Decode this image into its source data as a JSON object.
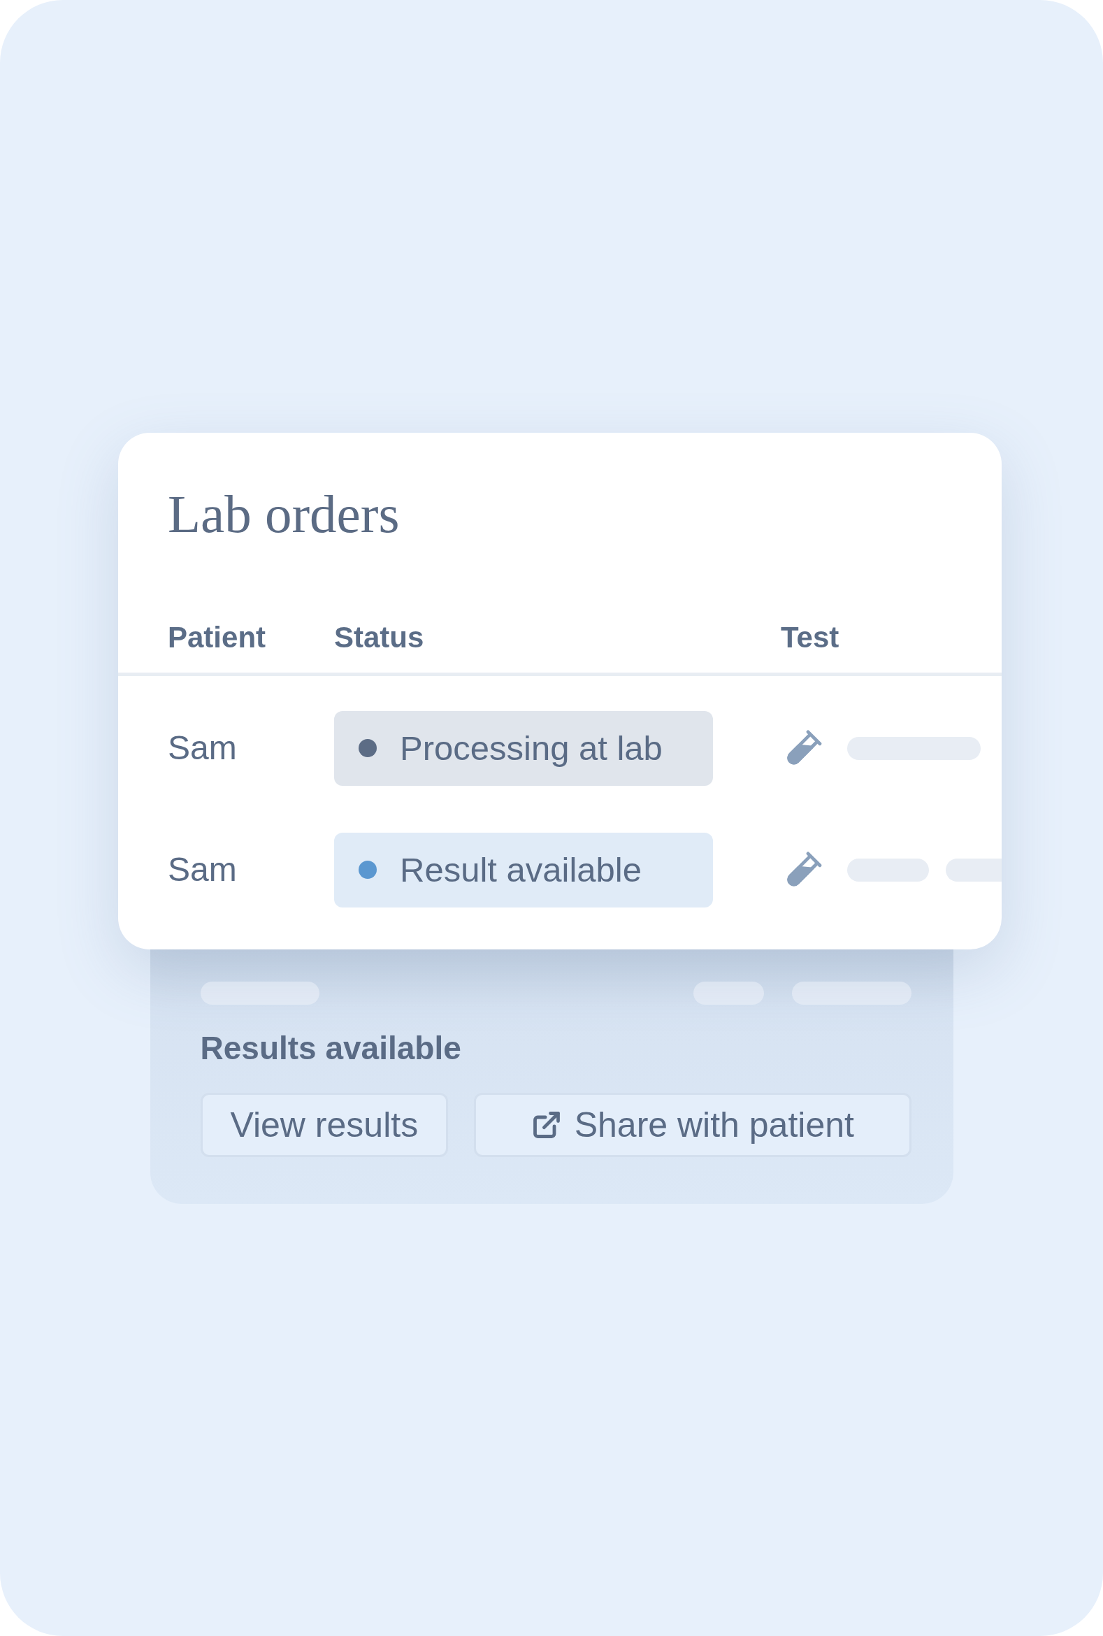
{
  "card": {
    "title": "Lab orders",
    "columns": [
      "Patient",
      "Status",
      "Test"
    ],
    "rows": [
      {
        "patient": "Sam",
        "status": {
          "label": "Processing at lab",
          "color": "#5c6c85"
        }
      },
      {
        "patient": "Sam",
        "status": {
          "label": "Result available",
          "color": "#5b97d0"
        }
      }
    ]
  },
  "results_panel": {
    "heading": "Results available",
    "buttons": [
      {
        "label": "View results",
        "kind": "plain"
      },
      {
        "label": "Share with patient",
        "kind": "share"
      }
    ]
  }
}
